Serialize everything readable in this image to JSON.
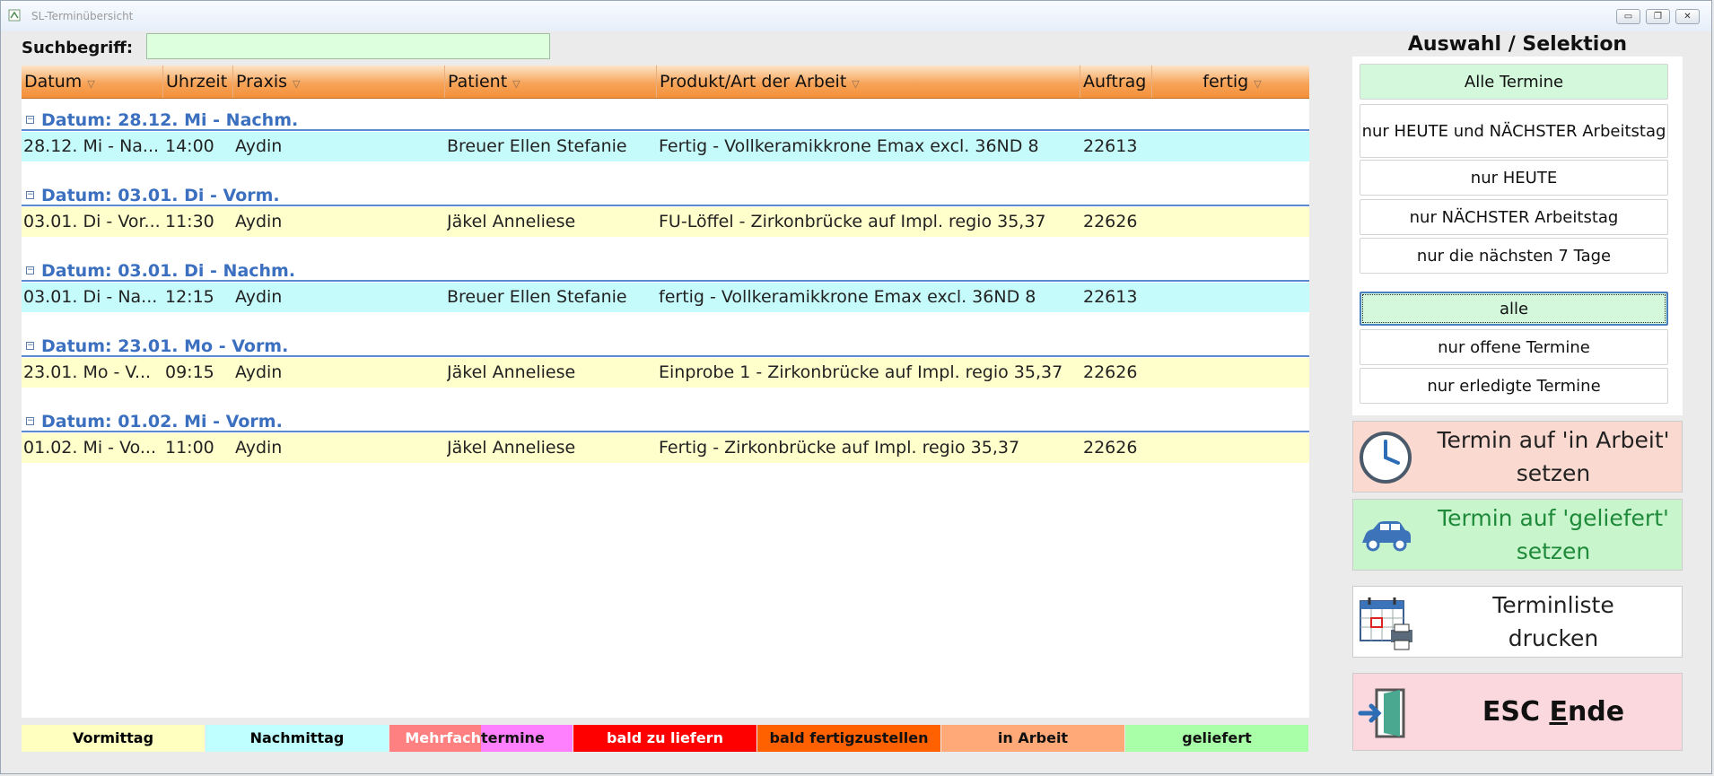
{
  "window": {
    "title": "SL-Terminübersicht",
    "minimize": "▭",
    "restore": "❐",
    "close": "✕"
  },
  "search": {
    "label": "Suchbegriff:",
    "value": ""
  },
  "grid": {
    "columns": [
      "Datum",
      "Uhrzeit",
      "Praxis",
      "Patient",
      "Produkt/Art der Arbeit",
      "Auftrag",
      "fertig"
    ],
    "filter_icon": "▽",
    "groups": [
      {
        "title": "Datum: 28.12.  Mi - Nachm.",
        "row": {
          "datum": "28.12.  Mi - Na...",
          "uhrzeit": "14:00",
          "praxis": "Aydin",
          "patient": "Breuer Ellen Stefanie",
          "produkt": "Fertig - Vollkeramikkrone Emax excl. 36ND 8",
          "auftrag": "22613",
          "fertig": "",
          "kind": "nach"
        }
      },
      {
        "title": "Datum: 03.01.  Di - Vorm.",
        "row": {
          "datum": "03.01.  Di - Vor...",
          "uhrzeit": "11:30",
          "praxis": "Aydin",
          "patient": "Jäkel Anneliese",
          "produkt": "FU-Löffel - Zirkonbrücke auf Impl. regio 35,37",
          "auftrag": "22626",
          "fertig": "",
          "kind": "vorm"
        }
      },
      {
        "title": "Datum: 03.01.  Di - Nachm.",
        "row": {
          "datum": "03.01.  Di - Na...",
          "uhrzeit": "12:15",
          "praxis": "Aydin",
          "patient": "Breuer Ellen Stefanie",
          "produkt": "fertig - Vollkeramikkrone Emax excl. 36ND 8",
          "auftrag": "22613",
          "fertig": "",
          "kind": "nach"
        }
      },
      {
        "title": "Datum: 23.01.  Mo - Vorm.",
        "row": {
          "datum": "23.01.  Mo - V...",
          "uhrzeit": "09:15",
          "praxis": "Aydin",
          "patient": "Jäkel Anneliese",
          "produkt": "Einprobe 1 - Zirkonbrücke auf Impl. regio 35,37",
          "auftrag": "22626",
          "fertig": "",
          "kind": "vorm"
        }
      },
      {
        "title": "Datum: 01.02.  Mi - Vorm.",
        "row": {
          "datum": "01.02.  Mi - Vo...",
          "uhrzeit": "11:00",
          "praxis": "Aydin",
          "patient": "Jäkel Anneliese",
          "produkt": "Fertig - Zirkonbrücke auf Impl. regio 35,37",
          "auftrag": "22626",
          "fertig": "",
          "kind": "vorm"
        }
      }
    ]
  },
  "legend": {
    "vormittag": "Vormittag",
    "nachmittag": "Nachmittag",
    "mehrfach_a": "Mehrfach",
    "mehrfach_b": "termine",
    "bald_liefern": "bald zu liefern",
    "bald_fertig": "bald fertigzustellen",
    "in_arbeit": "in Arbeit",
    "geliefert": "geliefert"
  },
  "selection": {
    "title": "Auswahl / Selektion",
    "date_filters": [
      "Alle Termine",
      "nur HEUTE und NÄCHSTER Arbeitstag",
      "nur HEUTE",
      "nur NÄCHSTER Arbeitstag",
      "nur die nächsten 7 Tage"
    ],
    "status_filters": [
      "alle",
      "nur offene Termine",
      "nur erledigte Termine"
    ],
    "selected_date_filter": "Alle Termine",
    "selected_status_filter": "alle"
  },
  "actions": {
    "in_arbeit": {
      "line1": "Termin auf 'in Arbeit'",
      "line2": "setzen",
      "icon": "clock-icon"
    },
    "geliefert": {
      "line1": "Termin auf 'geliefert'",
      "line2": "setzen",
      "icon": "car-icon"
    },
    "drucken": {
      "line1": "Terminliste",
      "line2": "drucken",
      "icon": "calendar-print-icon"
    },
    "ende": {
      "pre": "ESC ",
      "key": "E",
      "post": "nde",
      "icon": "exit-door-icon"
    }
  },
  "colors": {
    "vormittag": "#ffffc0",
    "nachmittag": "#c0ffff",
    "mehrfach_a": "#ff8080",
    "mehrfach_b": "#ff80ff",
    "bald_liefern": "#ff0000",
    "bald_fertig": "#ff6000",
    "in_arbeit": "#ffa878",
    "geliefert": "#a8ffa8",
    "group_title": "#3b6fbf",
    "header_orange": "#f39038"
  }
}
